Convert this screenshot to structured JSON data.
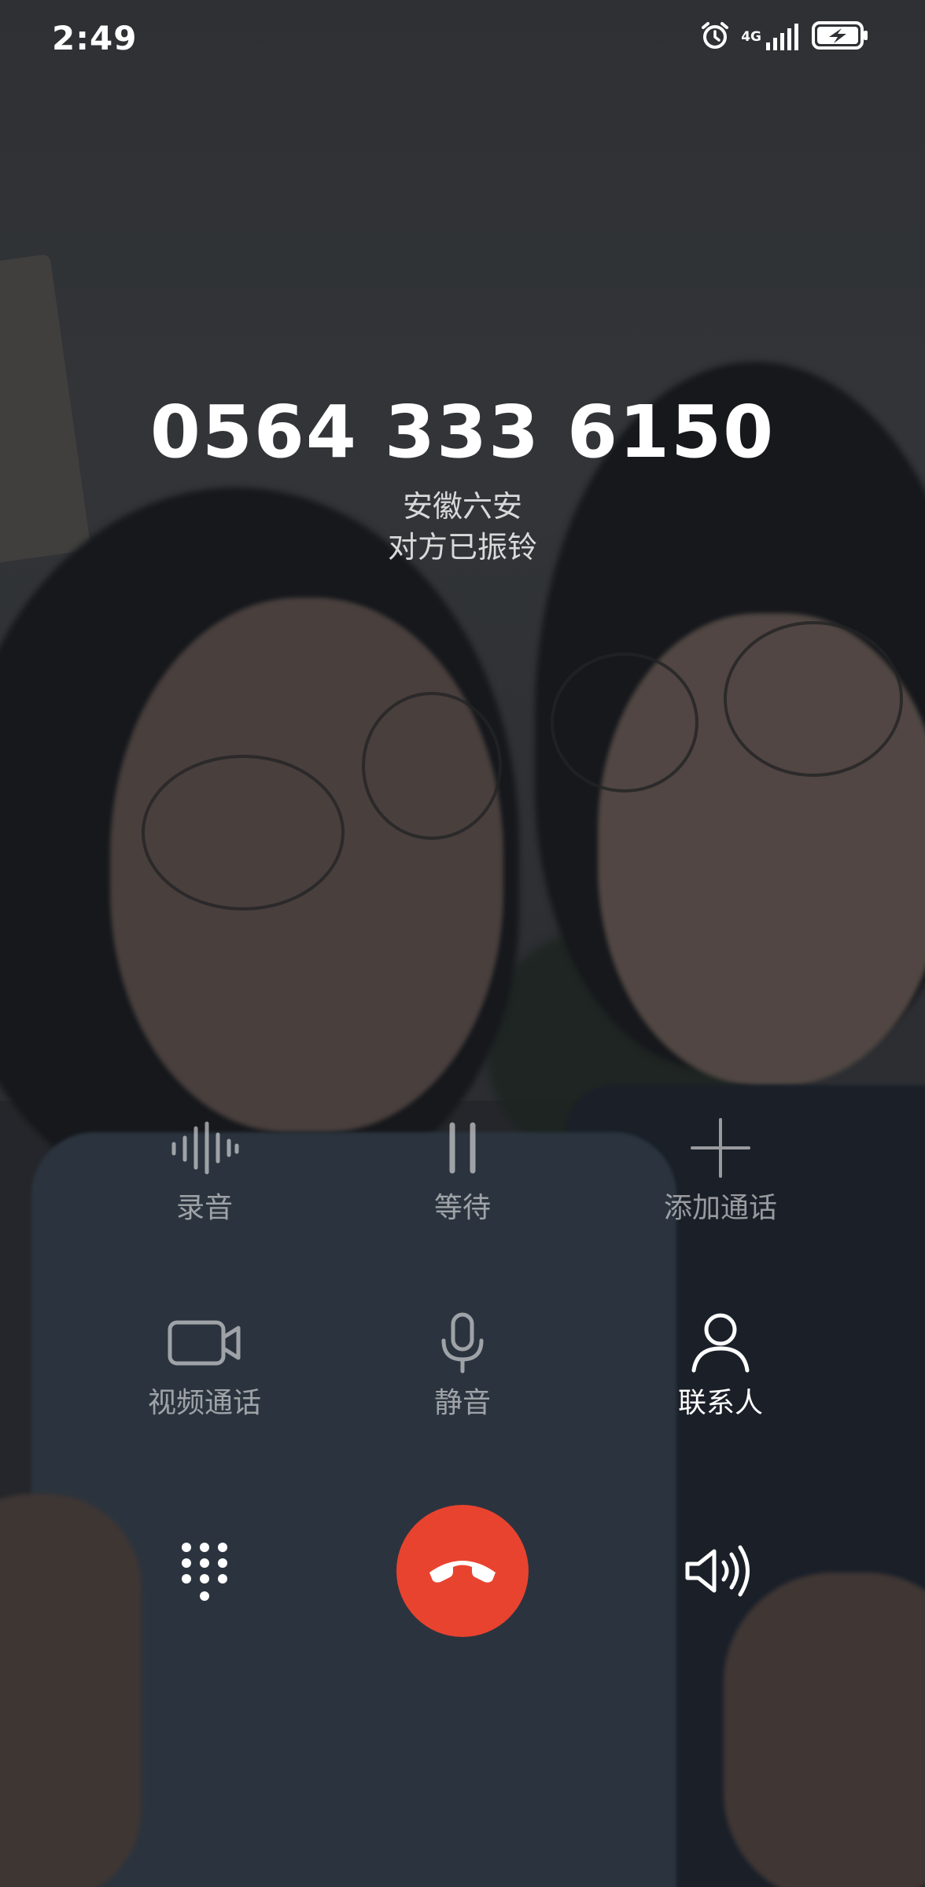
{
  "status_bar": {
    "time": "2:49",
    "network_label": "4G",
    "icons": [
      "alarm-icon",
      "signal-icon",
      "battery-charging-icon"
    ]
  },
  "caller": {
    "number": "0564 333 6150",
    "location": "安徽六安",
    "status": "对方已振铃"
  },
  "actions": {
    "record": {
      "label": "录音",
      "icon": "waveform-icon"
    },
    "hold": {
      "label": "等待",
      "icon": "pause-icon"
    },
    "add_call": {
      "label": "添加通话",
      "icon": "plus-icon"
    },
    "video_call": {
      "label": "视频通话",
      "icon": "video-camera-icon"
    },
    "mute": {
      "label": "静音",
      "icon": "microphone-icon"
    },
    "contacts": {
      "label": "联系人",
      "icon": "person-icon"
    }
  },
  "bottom_bar": {
    "dialpad_icon": "dialpad-icon",
    "end_call_icon": "hang-up-icon",
    "speaker_icon": "speaker-icon"
  },
  "colors": {
    "end_call": "#e8432f",
    "text": "#ffffff",
    "subtext": "#d9d9d9"
  }
}
